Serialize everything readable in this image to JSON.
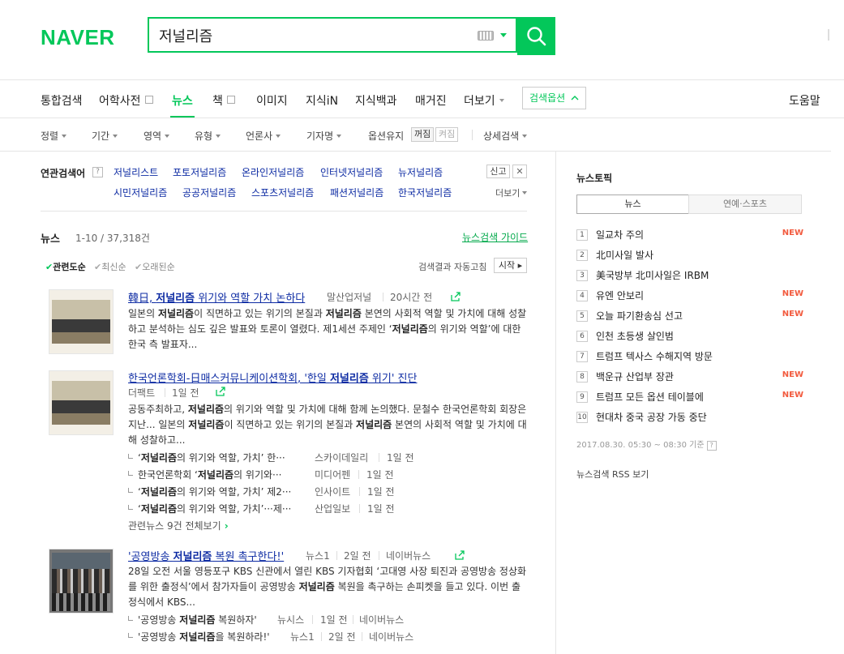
{
  "header": {
    "logo": "NAVER",
    "query": "저널리즘"
  },
  "colors": {
    "brand": "#03c75a",
    "link": "#0d2ba3",
    "new_badge": "#f25b3f"
  },
  "icons": [
    "keyboard-icon",
    "dropdown-caret-icon",
    "search-icon",
    "share-icon",
    "chevron-up-icon",
    "close-icon",
    "check-icon",
    "chevron-right-icon"
  ],
  "tabs": [
    {
      "label": "통합검색"
    },
    {
      "label": "어학사전"
    },
    {
      "label": "뉴스"
    },
    {
      "label": "책"
    },
    {
      "label": "이미지"
    },
    {
      "label": "지식iN"
    },
    {
      "label": "지식백과"
    },
    {
      "label": "매거진"
    },
    {
      "label": "더보기"
    }
  ],
  "search_options_label": "검색옵션",
  "help_label": "도움말",
  "filters": {
    "items": [
      {
        "label": "정렬"
      },
      {
        "label": "기간"
      },
      {
        "label": "영역"
      },
      {
        "label": "유형"
      },
      {
        "label": "언론사"
      },
      {
        "label": "기자명"
      }
    ],
    "option_keep": "옵션유지",
    "keep_on": "꺼짐",
    "keep_off": "켜짐",
    "detail": "상세검색"
  },
  "related": {
    "title": "연관검색어",
    "items": [
      "저널리스트",
      "포토저널리즘",
      "온라인저널리즘",
      "인터넷저널리즘",
      "뉴저널리즘",
      "시민저널리즘",
      "공공저널리즘",
      "스포츠저널리즘",
      "패션저널리즘",
      "한국저널리즘"
    ],
    "report": "신고",
    "more": "더보기"
  },
  "news": {
    "title": "뉴스",
    "count": "1-10 / 37,318건",
    "guide": "뉴스검색 가이드",
    "sorts": [
      "관련도순",
      "최신순",
      "오래된순"
    ],
    "auto_fix": "검색결과 자동고침",
    "start": "시작",
    "related_all": "관련뉴스 9건 전체보기",
    "items": [
      {
        "title_pre": "韓日, ",
        "title_hl": "저널리즘",
        "title_post": " 위기와 역할 가치 논하다",
        "source": "말산업저널",
        "time": "20시간 전",
        "desc": [
          {
            "t": "일본의 "
          },
          {
            "b": "저널리즘"
          },
          {
            "t": "이 직면하고 있는 위기의 본질과 "
          },
          {
            "b": "저널리즘"
          },
          {
            "t": " 본연의 사회적 역할 및 가치에 대해 성찰하고 분석하는 심도 깊은 발표와 토론이 열렸다. 제1세션 주제인 ‘"
          },
          {
            "b": "저널리즘"
          },
          {
            "t": "의 위기와 역할’에 대한 한국 측 발표자..."
          }
        ]
      },
      {
        "title_pre": "한국언론학회-日매스커뮤니케이션학회, '한일 ",
        "title_hl": "저널리즘",
        "title_post": " 위기' 진단",
        "source": "더팩트",
        "time": "1일 전",
        "desc": [
          {
            "t": "공동주최하고, "
          },
          {
            "b": "저널리즘"
          },
          {
            "t": "의 위기와 역할 및 가치에 대해 함께 논의했다. 문철수 한국언론학회 회장은 지난... 일본의 "
          },
          {
            "b": "저널리즘"
          },
          {
            "t": "이 직면하고 있는 위기의 본질과 "
          },
          {
            "b": "저널리즘"
          },
          {
            "t": " 본연의 사회적 역할 및 가치에 대해 성찰하고..."
          }
        ],
        "subs": [
          {
            "pre": "‘",
            "hl": "저널리즘",
            "post": "의 위기와 역할, 가치’ 한···",
            "source": "스카이데일리",
            "time": "1일 전"
          },
          {
            "pre": "한국언론학회 ‘",
            "hl": "저널리즘",
            "post": "의 위기와···",
            "source": "미디어펜",
            "time": "1일 전"
          },
          {
            "pre": "‘",
            "hl": "저널리즘",
            "post": "의 위기와 역할, 가치’ 제2···",
            "source": "인사이트",
            "time": "1일 전"
          },
          {
            "pre": "‘",
            "hl": "저널리즘",
            "post": "의 위기와 역할, 가치’···제···",
            "source": "산업일보",
            "time": "1일 전"
          }
        ]
      },
      {
        "title_pre": "'공영방송 ",
        "title_hl": "저널리즘",
        "title_post": " 복원 촉구한다!'",
        "source": "뉴스1",
        "time": "2일 전",
        "source2": "네이버뉴스",
        "desc": [
          {
            "t": "28일 오전 서울 영등포구 KBS 신관에서 열린 KBS 기자협회 ‘고대영 사장 퇴진과 공영방송 정상화를 위한 출정식’에서 참가자들이 공영방송 "
          },
          {
            "b": "저널리즘"
          },
          {
            "t": " 복원을 촉구하는 손피켓을 들고 있다. 이번 출정식에서 KBS..."
          }
        ],
        "subs": [
          {
            "pre": "'공영방송 ",
            "hl": "저널리즘",
            "post": " 복원하자'",
            "source": "뉴시스",
            "time": "1일 전",
            "source2": "네이버뉴스"
          },
          {
            "pre": "'공영방송 ",
            "hl": "저널리즘",
            "post": "을 복원하라!'",
            "source": "뉴스1",
            "time": "2일 전",
            "source2": "네이버뉴스"
          }
        ]
      }
    ]
  },
  "topics": {
    "title": "뉴스토픽",
    "tab_news": "뉴스",
    "tab_ent": "연예·스포츠",
    "new_label": "NEW",
    "items": [
      {
        "num": "1",
        "title": "일교차 주의",
        "is_new": true
      },
      {
        "num": "2",
        "title": "北미사일 발사",
        "is_new": false
      },
      {
        "num": "3",
        "title": "美국방부 北미사일은 IRBM",
        "is_new": false
      },
      {
        "num": "4",
        "title": "유엔 안보리",
        "is_new": true
      },
      {
        "num": "5",
        "title": "오늘 파기환송심 선고",
        "is_new": true
      },
      {
        "num": "6",
        "title": "인천 초등생 살인범",
        "is_new": false
      },
      {
        "num": "7",
        "title": "트럼프 텍사스 수해지역 방문",
        "is_new": false
      },
      {
        "num": "8",
        "title": "백운규 산업부 장관",
        "is_new": true
      },
      {
        "num": "9",
        "title": "트럼프 모든 옵션 테이블에",
        "is_new": true
      },
      {
        "num": "10",
        "title": "현대차 중국 공장 가동 중단",
        "is_new": false
      }
    ],
    "time": "2017.08.30. 05:30 ~ 08:30 기준",
    "rss": "뉴스검색 RSS 보기"
  }
}
